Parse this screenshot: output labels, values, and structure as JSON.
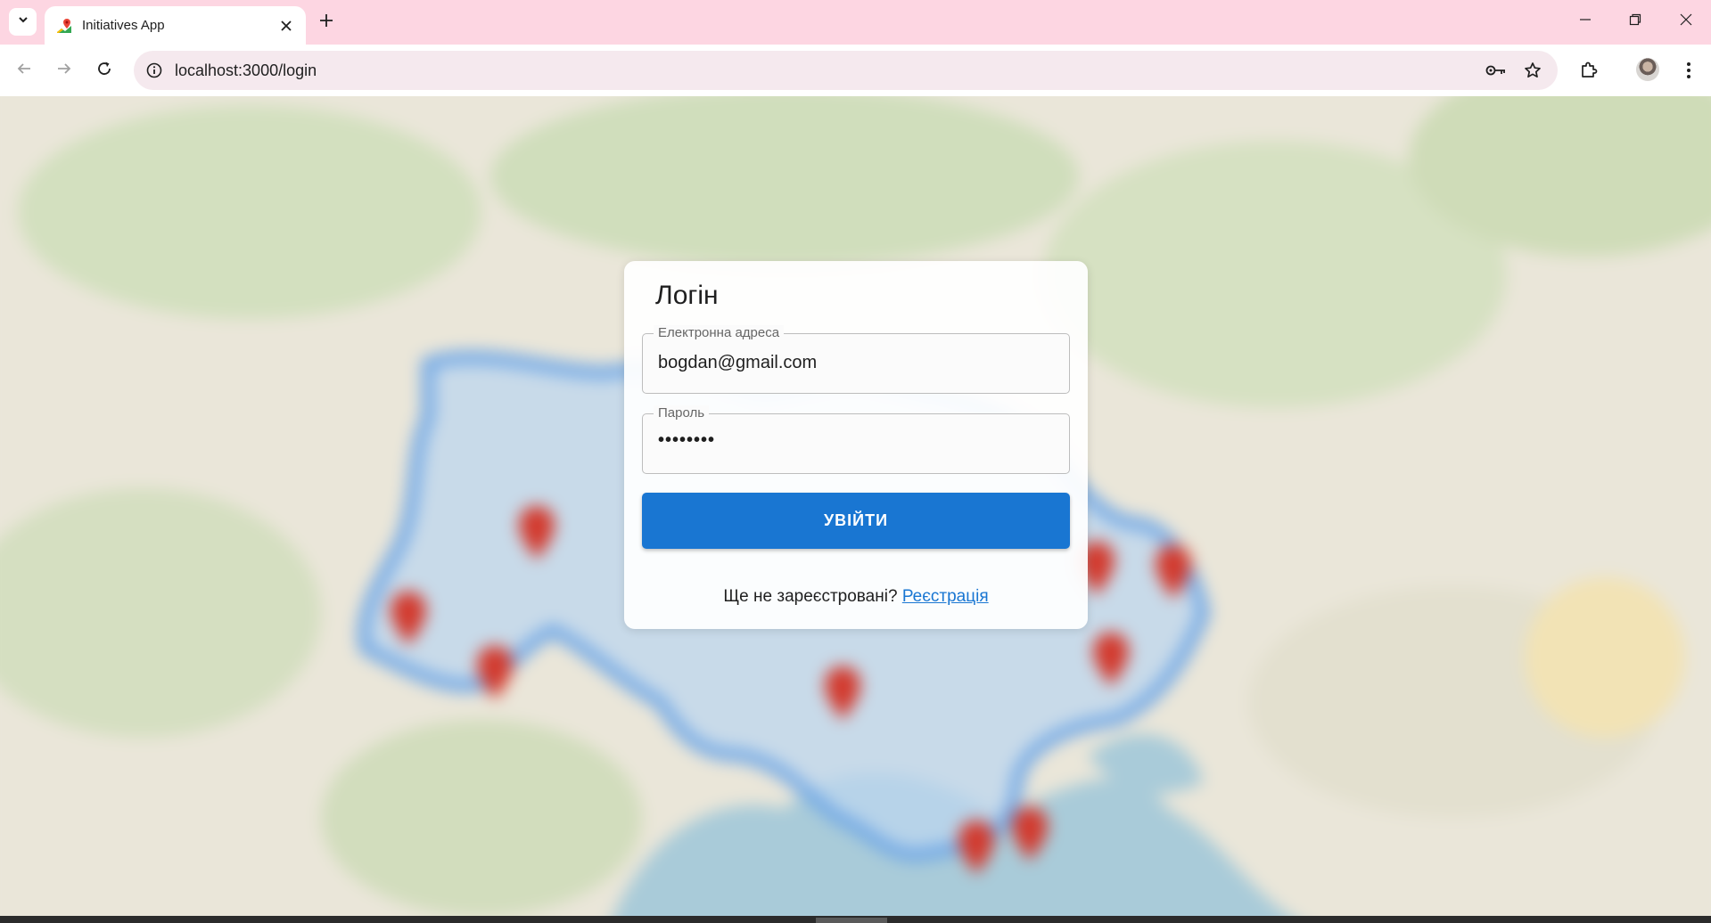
{
  "browser": {
    "tab_title": "Initiatives App",
    "url": "localhost:3000/login"
  },
  "login": {
    "title": "Логін",
    "email_label": "Електронна адреса",
    "email_value": "bogdan@gmail.com",
    "password_label": "Пароль",
    "password_mask": "••••••••",
    "submit_label": "УВІЙТИ",
    "register_prompt": "Ще не зареєстровані?",
    "register_link": "Реєстрація"
  },
  "colors": {
    "tabstrip_bg": "#fdd6e2",
    "omnibox_bg": "#f5e9ee",
    "primary": "#1976d2",
    "marker": "#d23a2e",
    "region_fill": "#bcd6ee"
  },
  "icons": {
    "tab_list": "chevron-down-icon",
    "favicon": "map-pin-favicon",
    "tab_close": "close-icon",
    "new_tab": "plus-icon",
    "back": "arrow-left-icon",
    "forward": "arrow-right-icon",
    "reload": "reload-icon",
    "site_info": "info-icon",
    "password_manager": "key-icon",
    "bookmark": "star-icon",
    "extensions": "puzzle-icon",
    "menu": "kebab-menu-icon"
  }
}
